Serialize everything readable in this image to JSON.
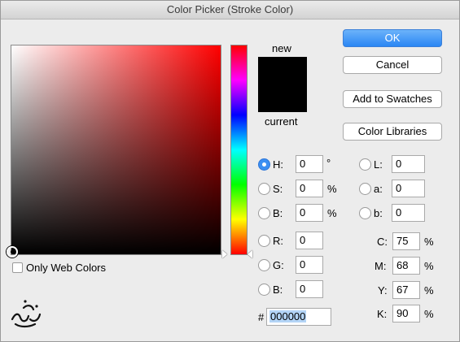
{
  "window": {
    "title": "Color Picker (Stroke Color)"
  },
  "swatch": {
    "new_label": "new",
    "current_label": "current",
    "new_color": "#000000",
    "current_color": "#000000"
  },
  "buttons": {
    "ok": "OK",
    "cancel": "Cancel",
    "add_to_swatches": "Add to Swatches",
    "color_libraries": "Color Libraries"
  },
  "options": {
    "only_web_colors": "Only Web Colors"
  },
  "hsb": {
    "h_label": "H:",
    "h_value": "0",
    "h_unit": "°",
    "s_label": "S:",
    "s_value": "0",
    "s_unit": "%",
    "b_label": "B:",
    "b_value": "0",
    "b_unit": "%"
  },
  "lab": {
    "l_label": "L:",
    "l_value": "0",
    "a_label": "a:",
    "a_value": "0",
    "b_label": "b:",
    "b_value": "0"
  },
  "rgb": {
    "r_label": "R:",
    "r_value": "0",
    "g_label": "G:",
    "g_value": "0",
    "b_label": "B:",
    "b_value": "0"
  },
  "cmyk": {
    "c_label": "C:",
    "c_value": "75",
    "c_unit": "%",
    "m_label": "M:",
    "m_value": "68",
    "m_unit": "%",
    "y_label": "Y:",
    "y_value": "67",
    "y_unit": "%",
    "k_label": "K:",
    "k_value": "90",
    "k_unit": "%"
  },
  "hex": {
    "label": "#",
    "value": "000000"
  },
  "selected_mode": "H",
  "icons": {
    "field_marker": "circle-marker-icon",
    "hue_arrows": "triangle-arrow-icon",
    "watermark": "logo-watermark"
  }
}
